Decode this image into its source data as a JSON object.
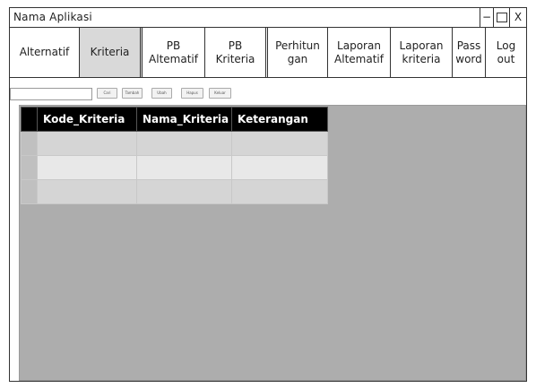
{
  "window": {
    "title": "Nama Aplikasi",
    "min_label": "−",
    "close_label": "X"
  },
  "tabs": [
    {
      "label": "Alternatif",
      "active": false
    },
    {
      "label": "Kriteria",
      "active": true
    },
    {
      "label": "PB\nAltematif",
      "active": false
    },
    {
      "label": "PB\nKriteria",
      "active": false
    },
    {
      "label": "Perhitun\ngan",
      "active": false
    },
    {
      "label": "Laporan\nAltematif",
      "active": false
    },
    {
      "label": "Laporan\nkriteria",
      "active": false
    },
    {
      "label": "Pass\nword",
      "active": false
    },
    {
      "label": "Log\nout",
      "active": false
    }
  ],
  "toolbar": {
    "search_value": "",
    "cari_label": "Cari",
    "tambah_label": "Tambah",
    "ubah_label": "Ubah",
    "hapus_label": "Hapus",
    "keluar_label": "Keluar"
  },
  "grid": {
    "columns": [
      "Kode_Kriteria",
      "Nama_Kriteria",
      "Keterangan"
    ],
    "rows": [
      [
        "",
        "",
        ""
      ],
      [
        "",
        "",
        ""
      ],
      [
        "",
        "",
        ""
      ]
    ]
  },
  "colors": {
    "content_bg": "#adadad",
    "active_tab_bg": "#d9d9d9",
    "header_bg": "#000000"
  }
}
